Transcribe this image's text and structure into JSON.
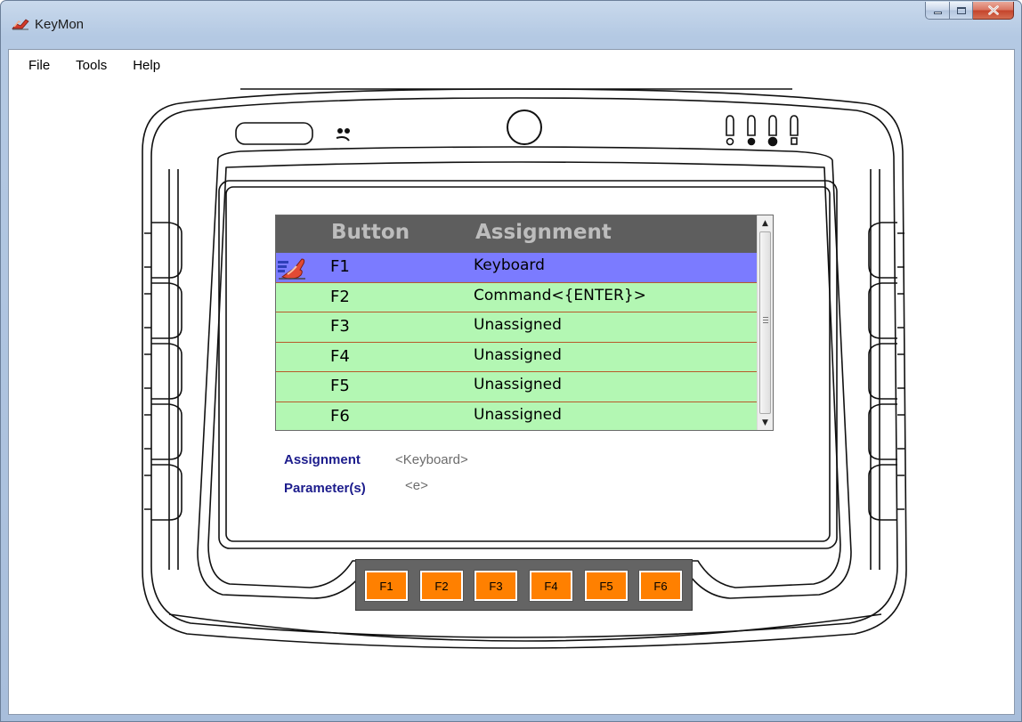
{
  "window": {
    "title": "KeyMon",
    "app_icon": "keymon-hand-icon"
  },
  "menu": [
    "File",
    "Tools",
    "Help"
  ],
  "grid": {
    "headers": {
      "button": "Button",
      "assignment": "Assignment"
    },
    "rows": [
      {
        "button": "F1",
        "assignment": "Keyboard",
        "selected": true
      },
      {
        "button": "F2",
        "assignment": "Command<{ENTER}>"
      },
      {
        "button": "F3",
        "assignment": "Unassigned"
      },
      {
        "button": "F4",
        "assignment": "Unassigned"
      },
      {
        "button": "F5",
        "assignment": "Unassigned"
      },
      {
        "button": "F6",
        "assignment": "Unassigned"
      }
    ],
    "row_colors": {
      "normal": "#b3f7b3",
      "selected": "#7b7bff",
      "separator": "#b85a2a"
    }
  },
  "details": {
    "assignment_label": "Assignment",
    "assignment_value": "<Keyboard>",
    "parameters_label": "Parameter(s)",
    "parameters_value": "<e>"
  },
  "function_keys": [
    "F1",
    "F2",
    "F3",
    "F4",
    "F5",
    "F6"
  ],
  "colors": {
    "function_key": "#ff8000",
    "header": "#5e5e5e"
  }
}
